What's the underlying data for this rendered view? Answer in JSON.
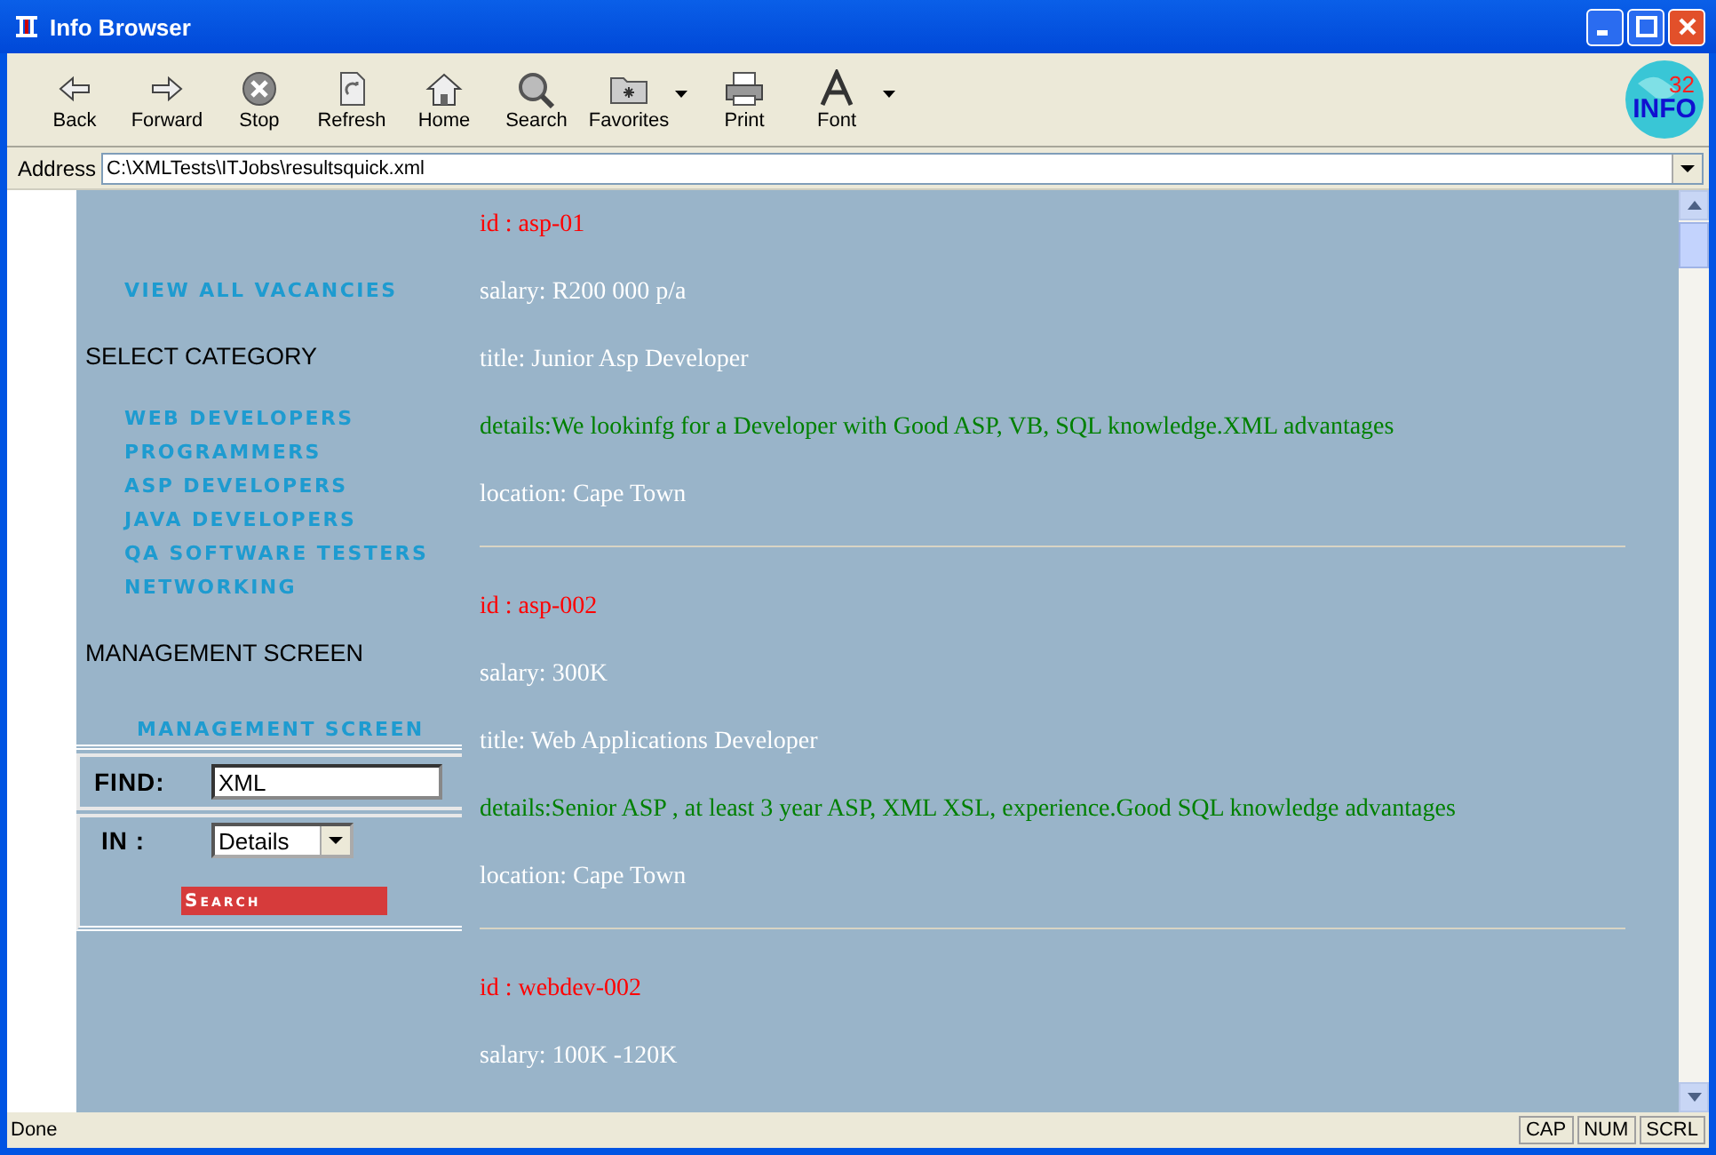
{
  "window": {
    "title": "Info Browser"
  },
  "toolbar": [
    {
      "label": "Back",
      "kind": "back",
      "has_menu": false
    },
    {
      "label": "Forward",
      "kind": "forward",
      "has_menu": false
    },
    {
      "label": "Stop",
      "kind": "stop",
      "has_menu": false
    },
    {
      "label": "Refresh",
      "kind": "refresh",
      "has_menu": false
    },
    {
      "label": "Home",
      "kind": "home",
      "has_menu": false
    },
    {
      "label": "Search",
      "kind": "search",
      "has_menu": false
    },
    {
      "label": "Favorites",
      "kind": "favorites",
      "has_menu": true
    },
    {
      "label": "Print",
      "kind": "print",
      "has_menu": false
    },
    {
      "label": "Font",
      "kind": "font",
      "has_menu": true
    }
  ],
  "logo": {
    "number": "32",
    "text": "INFO"
  },
  "address": {
    "label": "Address",
    "value": "C:\\XMLTests\\ITJobs\\resultsquick.xml"
  },
  "sidebar": {
    "view_all": "VIEW ALL VACANCIES",
    "category_heading": "SELECT CATEGORY",
    "categories": [
      "WEB DEVELOPERS",
      "PROGRAMMERS",
      "ASP DEVELOPERS",
      "JAVA DEVELOPERS",
      "QA SOFTWARE TESTERS",
      "NETWORKING"
    ],
    "management_heading": "MANAGEMENT SCREEN",
    "management_link": "MANAGEMENT SCREEN",
    "find_label": "FIND:",
    "find_value": "XML",
    "in_label": "IN :",
    "in_value": "Details",
    "search_button": "Search"
  },
  "records": [
    {
      "lines": [
        {
          "kind": "id",
          "text": "id : asp-01"
        },
        {
          "kind": "plain",
          "text": "salary: R200 000 p/a"
        },
        {
          "kind": "plain",
          "text": "title: Junior Asp Developer"
        },
        {
          "kind": "details",
          "text": "details:We lookinfg for a Developer with Good ASP, VB, SQL knowledge.XML advantages"
        },
        {
          "kind": "plain",
          "text": "location: Cape Town"
        }
      ]
    },
    {
      "lines": [
        {
          "kind": "id",
          "text": "id : asp-002"
        },
        {
          "kind": "plain",
          "text": "salary: 300K"
        },
        {
          "kind": "plain",
          "text": "title: Web Applications Developer"
        },
        {
          "kind": "details",
          "text": "details:Senior ASP , at least 3 year ASP, XML XSL, experience.Good SQL knowledge advantages"
        },
        {
          "kind": "plain",
          "text": "location: Cape Town"
        }
      ]
    },
    {
      "lines": [
        {
          "kind": "id",
          "text": "id : webdev-002"
        },
        {
          "kind": "plain",
          "text": "salary: 100K -120K"
        }
      ]
    }
  ],
  "status_bar": {
    "text": "Done",
    "indicators": [
      "CAP",
      "NUM",
      "SCRL"
    ]
  }
}
